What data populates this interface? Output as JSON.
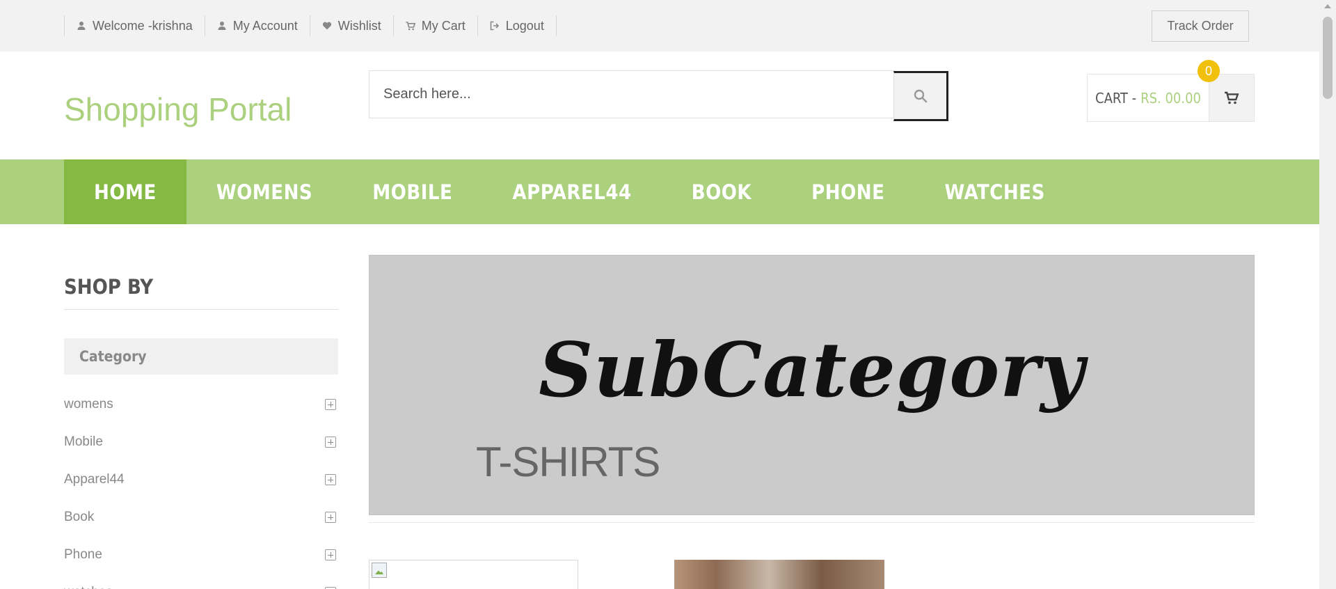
{
  "topbar": {
    "links": [
      {
        "label": "Welcome -krishna",
        "icon": "user-icon"
      },
      {
        "label": "My Account",
        "icon": "user-icon"
      },
      {
        "label": "Wishlist",
        "icon": "heart-icon"
      },
      {
        "label": "My Cart",
        "icon": "cart-icon"
      },
      {
        "label": "Logout",
        "icon": "sign-out-icon"
      }
    ],
    "track_order": "Track Order"
  },
  "header": {
    "logo": "Shopping Portal",
    "search_placeholder": "Search here...",
    "cart_label": "CART -",
    "cart_amount": "RS. 00.00",
    "cart_count": "0"
  },
  "nav": {
    "items": [
      "HOME",
      "WOMENS",
      "MOBILE",
      "APPAREL44",
      "BOOK",
      "PHONE",
      "WATCHES"
    ],
    "active": "HOME"
  },
  "sidebar": {
    "title": "SHOP BY",
    "category_heading": "Category",
    "categories": [
      "womens",
      "Mobile",
      "Apparel44",
      "Book",
      "Phone",
      "watches"
    ]
  },
  "banner": {
    "script_text": "SubCategory",
    "subcategory": "T-SHIRTS"
  },
  "colors": {
    "brand_green": "#abd07e",
    "active_green": "#84b943",
    "badge_yellow": "#f0c00a"
  }
}
